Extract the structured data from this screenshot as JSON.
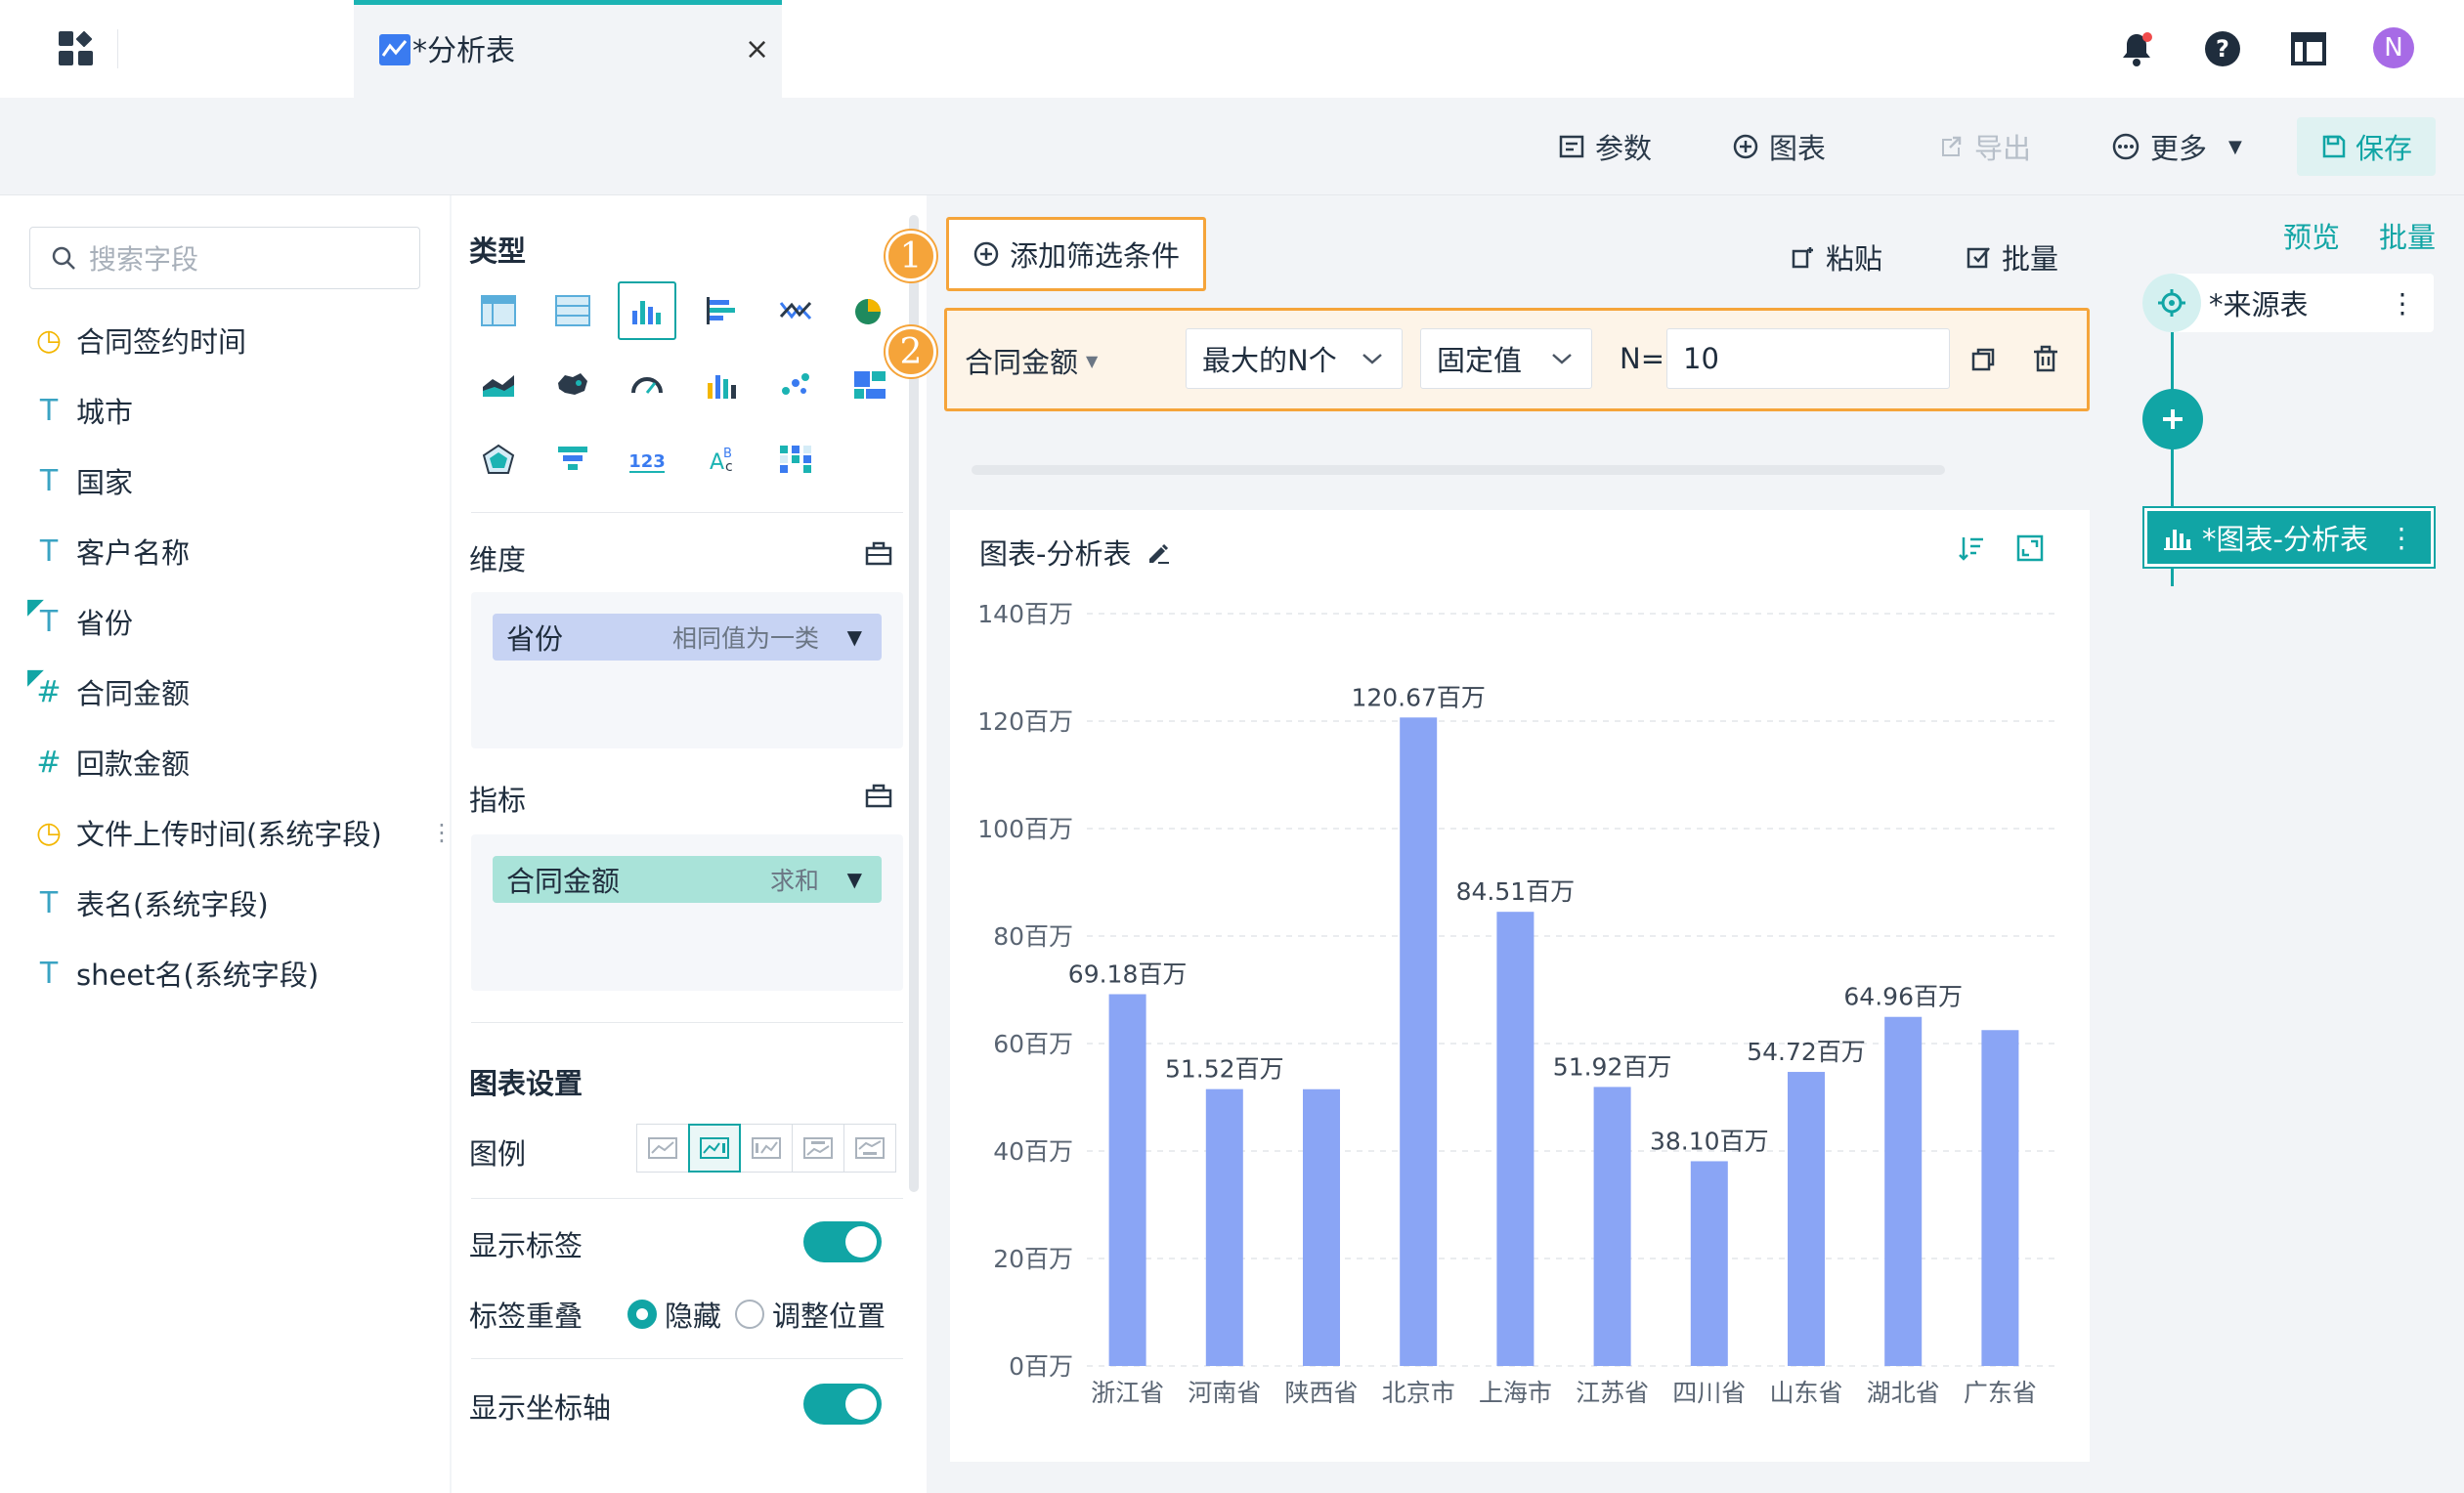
{
  "tab": {
    "title": "*分析表",
    "close": "×"
  },
  "toolbar": {
    "params": "参数",
    "chart": "图表",
    "export": "导出",
    "more": "更多",
    "save": "保存"
  },
  "user": {
    "avatar_letter": "N"
  },
  "fields": {
    "search_placeholder": "搜索字段",
    "items": [
      {
        "type": "date",
        "label": "合同签约时间"
      },
      {
        "type": "text",
        "label": "城市"
      },
      {
        "type": "text",
        "label": "国家"
      },
      {
        "type": "text",
        "label": "客户名称"
      },
      {
        "type": "text-edited",
        "label": "省份"
      },
      {
        "type": "number-edited",
        "label": "合同金额"
      },
      {
        "type": "number",
        "label": "回款金额"
      },
      {
        "type": "date",
        "label": "文件上传时间(系统字段)"
      },
      {
        "type": "text",
        "label": "表名(系统字段)"
      },
      {
        "type": "text",
        "label": "sheet名(系统字段)"
      }
    ]
  },
  "config": {
    "type_title": "类型",
    "dimension_title": "维度",
    "dimension_field": "省份",
    "dimension_sub": "相同值为一类",
    "metric_title": "指标",
    "metric_field": "合同金额",
    "metric_sub": "求和",
    "chart_settings_title": "图表设置",
    "legend_label": "图例",
    "show_label": "显示标签",
    "label_overlap": "标签重叠",
    "radio_hide": "隐藏",
    "radio_adjust": "调整位置",
    "show_axis": "显示坐标轴"
  },
  "filter": {
    "add_label": "添加筛选条件",
    "badge1": "1",
    "badge2": "2",
    "paste": "粘贴",
    "batch": "批量",
    "field": "合同金额",
    "mode": "最大的N个",
    "value_type": "固定值",
    "n_label": "N=",
    "n_value": "10"
  },
  "chart_card": {
    "title": "图表-分析表"
  },
  "chart_data": {
    "type": "bar",
    "categories": [
      "浙江省",
      "河南省",
      "陕西省",
      "北京市",
      "上海市",
      "江苏省",
      "四川省",
      "山东省",
      "湖北省",
      "广东省"
    ],
    "values": [
      69.18,
      51.52,
      51.5,
      120.67,
      84.51,
      51.92,
      38.1,
      54.72,
      64.96,
      62.5
    ],
    "data_labels": [
      "69.18百万",
      "51.52百万",
      "",
      "120.67百万",
      "84.51百万",
      "51.92百万",
      "38.10百万",
      "54.72百万",
      "64.96百万",
      ""
    ],
    "y_ticks": [
      "0百万",
      "20百万",
      "40百万",
      "60百万",
      "80百万",
      "100百万",
      "120百万",
      "140百万"
    ],
    "y_tick_values": [
      0,
      20,
      40,
      60,
      80,
      100,
      120,
      140
    ],
    "ylim": [
      0,
      140
    ],
    "bar_color": "#8aa5f5",
    "grid": true
  },
  "flow": {
    "preview": "预览",
    "batch": "批量",
    "source_node": "*来源表",
    "chart_node": "*图表-分析表",
    "accent": "#11a5a5"
  }
}
